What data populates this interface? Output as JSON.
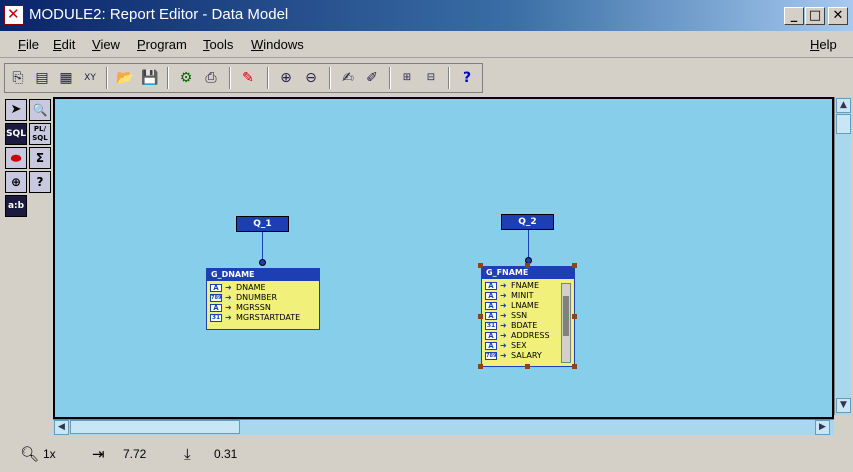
{
  "window": {
    "title": "MODULE2: Report Editor - Data Model"
  },
  "menu": [
    "File",
    "Edit",
    "View",
    "Program",
    "Tools",
    "Windows",
    "Help"
  ],
  "toolbar_icons": [
    "report-wizard-icon",
    "data-model-icon",
    "layout-icon",
    "parameter-form-icon",
    "open-icon",
    "save-icon",
    "run-icon",
    "print-icon",
    "eraser-icon",
    "zoom-in-icon",
    "zoom-out-icon",
    "edit-icon",
    "property-icon",
    "expand-icon",
    "collapse-icon",
    "help-icon"
  ],
  "palette": [
    "SQL",
    "PL/ SQL",
    "a:b"
  ],
  "queries": [
    {
      "name": "Q_1"
    },
    {
      "name": "Q_2"
    }
  ],
  "groups": [
    {
      "name": "G_DNAME",
      "columns": [
        {
          "type": "A",
          "name": "DNAME"
        },
        {
          "type": "789",
          "name": "DNUMBER"
        },
        {
          "type": "A",
          "name": "MGRSSN"
        },
        {
          "type": "31",
          "name": "MGRSTARTDATE"
        }
      ]
    },
    {
      "name": "G_FNAME",
      "columns": [
        {
          "type": "A",
          "name": "FNAME"
        },
        {
          "type": "A",
          "name": "MINIT"
        },
        {
          "type": "A",
          "name": "LNAME"
        },
        {
          "type": "A",
          "name": "SSN"
        },
        {
          "type": "31",
          "name": "BDATE"
        },
        {
          "type": "A",
          "name": "ADDRESS"
        },
        {
          "type": "A",
          "name": "SEX"
        },
        {
          "type": "789",
          "name": "SALARY"
        }
      ]
    }
  ],
  "status": {
    "zoom": "1x",
    "x_pos": "7.72",
    "y_pos": "0.31"
  }
}
